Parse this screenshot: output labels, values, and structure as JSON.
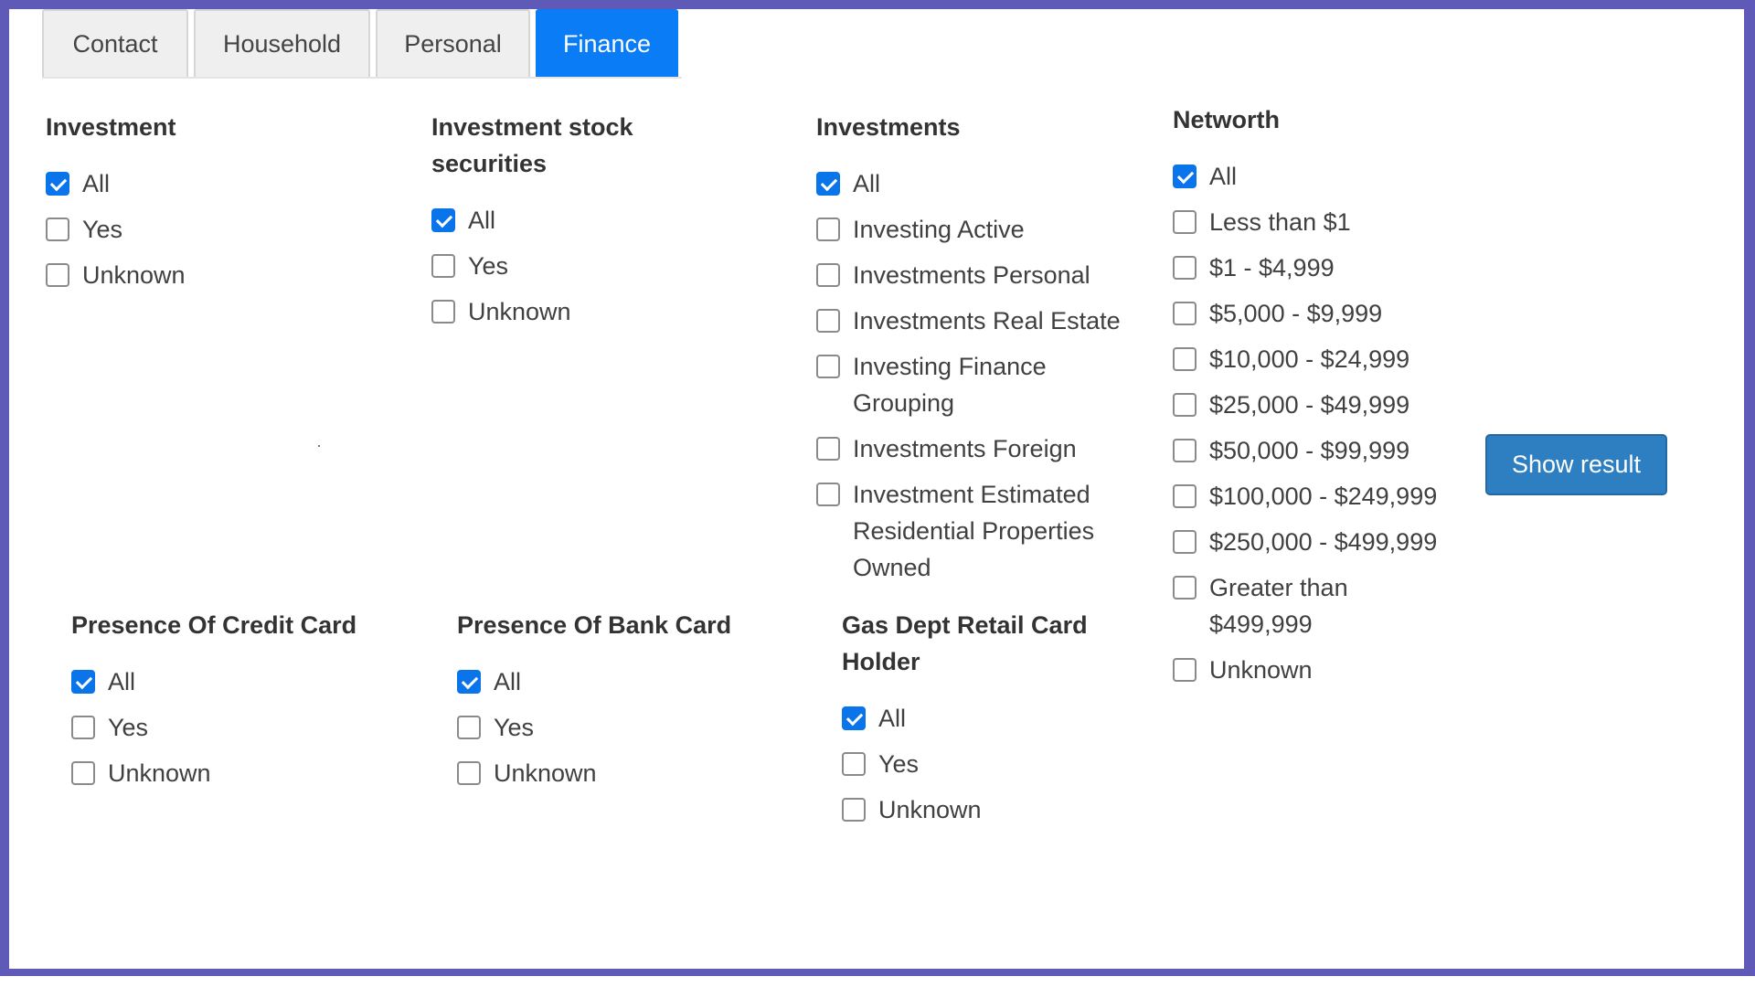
{
  "tabs": [
    {
      "label": "Contact",
      "active": false
    },
    {
      "label": "Household",
      "active": false
    },
    {
      "label": "Personal",
      "active": false
    },
    {
      "label": "Finance",
      "active": true
    }
  ],
  "groups": {
    "investment": {
      "title": "Investment",
      "options": [
        {
          "label": "All",
          "checked": true
        },
        {
          "label": "Yes",
          "checked": false
        },
        {
          "label": "Unknown",
          "checked": false
        }
      ]
    },
    "investment_stock": {
      "title": "Investment stock securities",
      "options": [
        {
          "label": "All",
          "checked": true
        },
        {
          "label": "Yes",
          "checked": false
        },
        {
          "label": "Unknown",
          "checked": false
        }
      ]
    },
    "investments": {
      "title": "Investments",
      "options": [
        {
          "label": "All",
          "checked": true
        },
        {
          "label": "Investing Active",
          "checked": false
        },
        {
          "label": "Investments Personal",
          "checked": false
        },
        {
          "label": "Investments Real Estate",
          "checked": false
        },
        {
          "label": "Investing Finance Grouping",
          "checked": false
        },
        {
          "label": "Investments Foreign",
          "checked": false
        },
        {
          "label": "Investment Estimated Residential Properties Owned",
          "checked": false
        }
      ]
    },
    "networth": {
      "title": "Networth",
      "options": [
        {
          "label": "All",
          "checked": true
        },
        {
          "label": "Less than $1",
          "checked": false
        },
        {
          "label": "$1 - $4,999",
          "checked": false
        },
        {
          "label": "$5,000 - $9,999",
          "checked": false
        },
        {
          "label": "$10,000 - $24,999",
          "checked": false
        },
        {
          "label": "$25,000 - $49,999",
          "checked": false
        },
        {
          "label": "$50,000 - $99,999",
          "checked": false
        },
        {
          "label": "$100,000 - $249,999",
          "checked": false
        },
        {
          "label": "$250,000 - $499,999",
          "checked": false
        },
        {
          "label": "Greater than $499,999",
          "checked": false
        },
        {
          "label": "Unknown",
          "checked": false
        }
      ]
    },
    "credit_card": {
      "title": "Presence Of Credit Card",
      "options": [
        {
          "label": "All",
          "checked": true
        },
        {
          "label": "Yes",
          "checked": false
        },
        {
          "label": "Unknown",
          "checked": false
        }
      ]
    },
    "bank_card": {
      "title": "Presence Of Bank Card",
      "options": [
        {
          "label": "All",
          "checked": true
        },
        {
          "label": "Yes",
          "checked": false
        },
        {
          "label": "Unknown",
          "checked": false
        }
      ]
    },
    "gas_dept": {
      "title": "Gas Dept Retail Card Holder",
      "options": [
        {
          "label": "All",
          "checked": true
        },
        {
          "label": "Yes",
          "checked": false
        },
        {
          "label": "Unknown",
          "checked": false
        }
      ]
    }
  },
  "show_result_label": "Show result",
  "colors": {
    "accent": "#0a7cf5",
    "checkbox_checked": "#0a74ea",
    "button": "#2e7ec2",
    "border": "#5f5ab8"
  }
}
